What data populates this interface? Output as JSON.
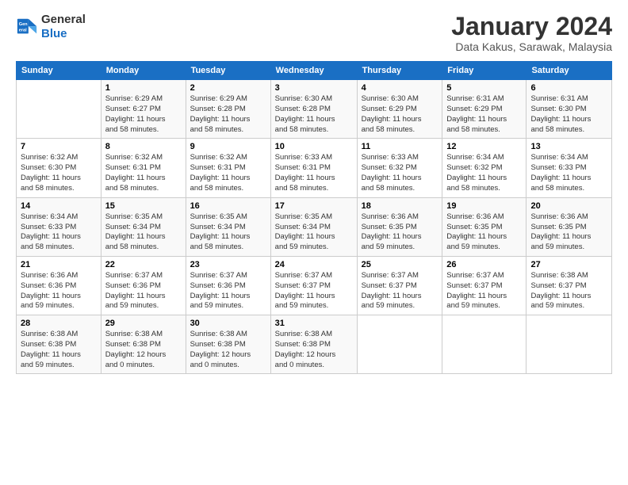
{
  "logo": {
    "line1": "General",
    "line2": "Blue"
  },
  "title": "January 2024",
  "subtitle": "Data Kakus, Sarawak, Malaysia",
  "days_header": [
    "Sunday",
    "Monday",
    "Tuesday",
    "Wednesday",
    "Thursday",
    "Friday",
    "Saturday"
  ],
  "weeks": [
    [
      {
        "num": "",
        "info": ""
      },
      {
        "num": "1",
        "info": "Sunrise: 6:29 AM\nSunset: 6:27 PM\nDaylight: 11 hours\nand 58 minutes."
      },
      {
        "num": "2",
        "info": "Sunrise: 6:29 AM\nSunset: 6:28 PM\nDaylight: 11 hours\nand 58 minutes."
      },
      {
        "num": "3",
        "info": "Sunrise: 6:30 AM\nSunset: 6:28 PM\nDaylight: 11 hours\nand 58 minutes."
      },
      {
        "num": "4",
        "info": "Sunrise: 6:30 AM\nSunset: 6:29 PM\nDaylight: 11 hours\nand 58 minutes."
      },
      {
        "num": "5",
        "info": "Sunrise: 6:31 AM\nSunset: 6:29 PM\nDaylight: 11 hours\nand 58 minutes."
      },
      {
        "num": "6",
        "info": "Sunrise: 6:31 AM\nSunset: 6:30 PM\nDaylight: 11 hours\nand 58 minutes."
      }
    ],
    [
      {
        "num": "7",
        "info": "Sunrise: 6:32 AM\nSunset: 6:30 PM\nDaylight: 11 hours\nand 58 minutes."
      },
      {
        "num": "8",
        "info": "Sunrise: 6:32 AM\nSunset: 6:31 PM\nDaylight: 11 hours\nand 58 minutes."
      },
      {
        "num": "9",
        "info": "Sunrise: 6:32 AM\nSunset: 6:31 PM\nDaylight: 11 hours\nand 58 minutes."
      },
      {
        "num": "10",
        "info": "Sunrise: 6:33 AM\nSunset: 6:31 PM\nDaylight: 11 hours\nand 58 minutes."
      },
      {
        "num": "11",
        "info": "Sunrise: 6:33 AM\nSunset: 6:32 PM\nDaylight: 11 hours\nand 58 minutes."
      },
      {
        "num": "12",
        "info": "Sunrise: 6:34 AM\nSunset: 6:32 PM\nDaylight: 11 hours\nand 58 minutes."
      },
      {
        "num": "13",
        "info": "Sunrise: 6:34 AM\nSunset: 6:33 PM\nDaylight: 11 hours\nand 58 minutes."
      }
    ],
    [
      {
        "num": "14",
        "info": "Sunrise: 6:34 AM\nSunset: 6:33 PM\nDaylight: 11 hours\nand 58 minutes."
      },
      {
        "num": "15",
        "info": "Sunrise: 6:35 AM\nSunset: 6:34 PM\nDaylight: 11 hours\nand 58 minutes."
      },
      {
        "num": "16",
        "info": "Sunrise: 6:35 AM\nSunset: 6:34 PM\nDaylight: 11 hours\nand 58 minutes."
      },
      {
        "num": "17",
        "info": "Sunrise: 6:35 AM\nSunset: 6:34 PM\nDaylight: 11 hours\nand 59 minutes."
      },
      {
        "num": "18",
        "info": "Sunrise: 6:36 AM\nSunset: 6:35 PM\nDaylight: 11 hours\nand 59 minutes."
      },
      {
        "num": "19",
        "info": "Sunrise: 6:36 AM\nSunset: 6:35 PM\nDaylight: 11 hours\nand 59 minutes."
      },
      {
        "num": "20",
        "info": "Sunrise: 6:36 AM\nSunset: 6:35 PM\nDaylight: 11 hours\nand 59 minutes."
      }
    ],
    [
      {
        "num": "21",
        "info": "Sunrise: 6:36 AM\nSunset: 6:36 PM\nDaylight: 11 hours\nand 59 minutes."
      },
      {
        "num": "22",
        "info": "Sunrise: 6:37 AM\nSunset: 6:36 PM\nDaylight: 11 hours\nand 59 minutes."
      },
      {
        "num": "23",
        "info": "Sunrise: 6:37 AM\nSunset: 6:36 PM\nDaylight: 11 hours\nand 59 minutes."
      },
      {
        "num": "24",
        "info": "Sunrise: 6:37 AM\nSunset: 6:37 PM\nDaylight: 11 hours\nand 59 minutes."
      },
      {
        "num": "25",
        "info": "Sunrise: 6:37 AM\nSunset: 6:37 PM\nDaylight: 11 hours\nand 59 minutes."
      },
      {
        "num": "26",
        "info": "Sunrise: 6:37 AM\nSunset: 6:37 PM\nDaylight: 11 hours\nand 59 minutes."
      },
      {
        "num": "27",
        "info": "Sunrise: 6:38 AM\nSunset: 6:37 PM\nDaylight: 11 hours\nand 59 minutes."
      }
    ],
    [
      {
        "num": "28",
        "info": "Sunrise: 6:38 AM\nSunset: 6:38 PM\nDaylight: 11 hours\nand 59 minutes."
      },
      {
        "num": "29",
        "info": "Sunrise: 6:38 AM\nSunset: 6:38 PM\nDaylight: 12 hours\nand 0 minutes."
      },
      {
        "num": "30",
        "info": "Sunrise: 6:38 AM\nSunset: 6:38 PM\nDaylight: 12 hours\nand 0 minutes."
      },
      {
        "num": "31",
        "info": "Sunrise: 6:38 AM\nSunset: 6:38 PM\nDaylight: 12 hours\nand 0 minutes."
      },
      {
        "num": "",
        "info": ""
      },
      {
        "num": "",
        "info": ""
      },
      {
        "num": "",
        "info": ""
      }
    ]
  ]
}
